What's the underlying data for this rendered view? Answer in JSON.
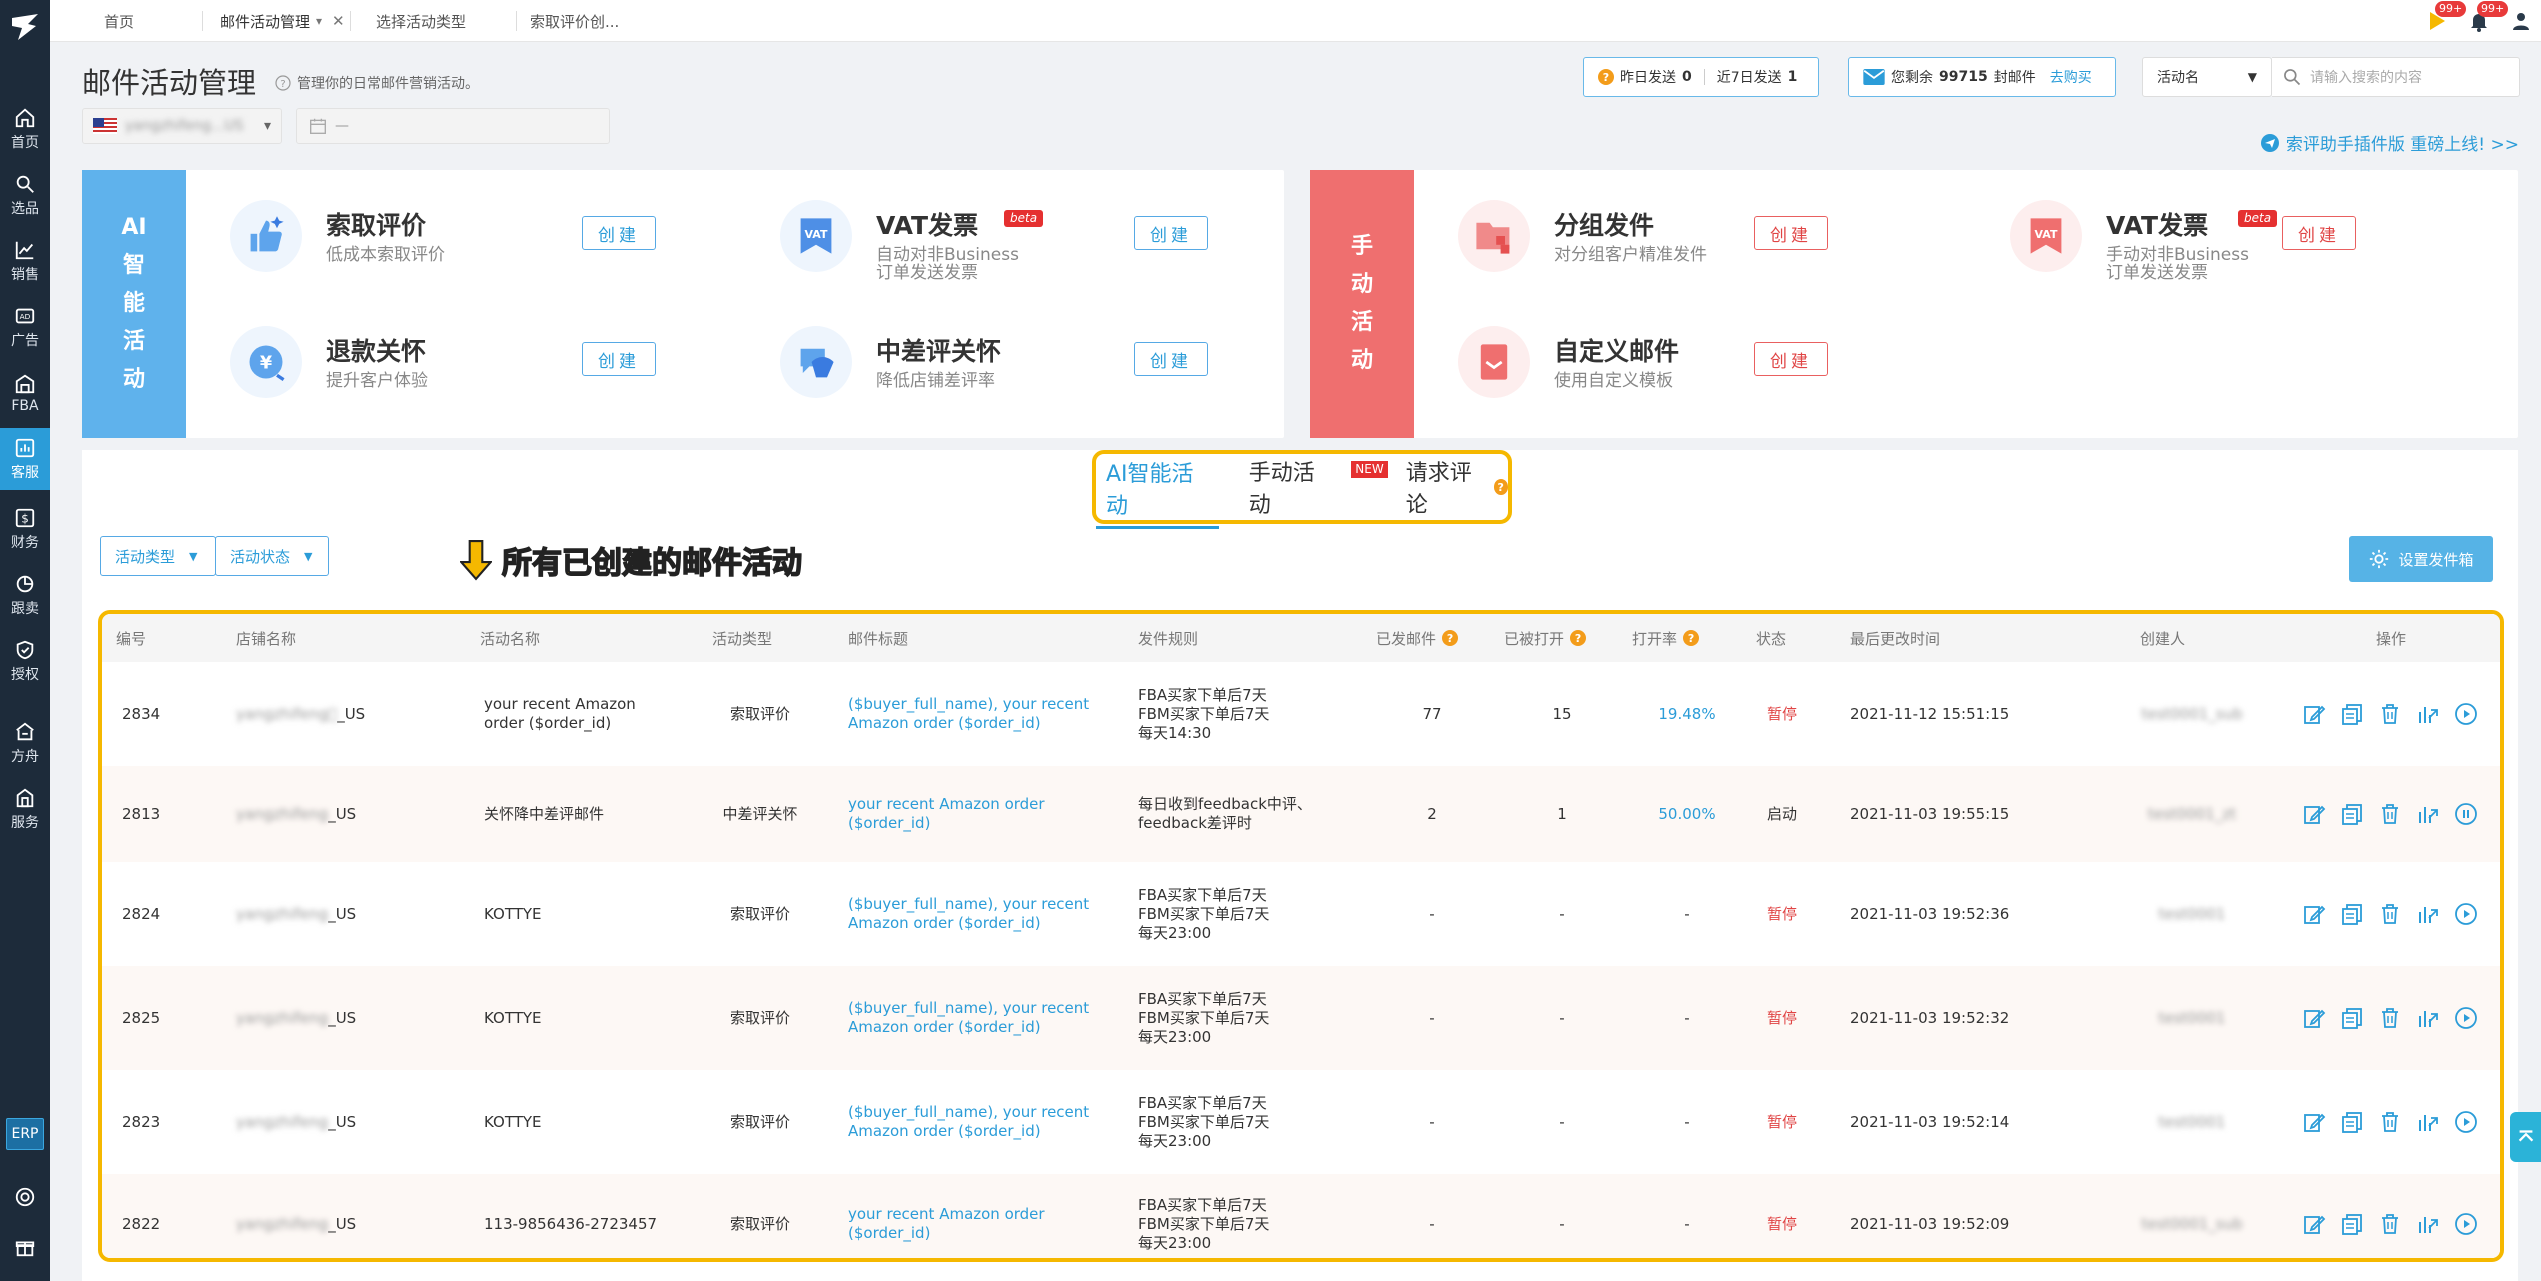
{
  "nav": {
    "items": [
      {
        "label": "首页"
      },
      {
        "label": "选品"
      },
      {
        "label": "销售"
      },
      {
        "label": "广告"
      },
      {
        "label": "FBA"
      },
      {
        "label": "客服"
      },
      {
        "label": "财务"
      },
      {
        "label": "跟卖"
      },
      {
        "label": "授权"
      },
      {
        "label": "方舟"
      },
      {
        "label": "服务"
      }
    ],
    "erp": "ERP"
  },
  "tabs": [
    {
      "label": "首页"
    },
    {
      "label": "邮件活动管理"
    },
    {
      "label": "选择活动类型"
    },
    {
      "label": "索取评价创..."
    }
  ],
  "top_badges": {
    "flag": "99+",
    "bell": "99+"
  },
  "header": {
    "title": "邮件活动管理",
    "desc": "管理你的日常邮件营销活动。",
    "store_value": "yangzhifeng...US",
    "date_value": "—",
    "yesterday_label": "昨日发送",
    "yesterday_value": "0",
    "week_label": "近7日发送",
    "week_value": "1",
    "quota_label": "您剩余",
    "quota_value": "99715",
    "quota_unit": "封邮件",
    "buy_link": "去购买",
    "search_type": "活动名",
    "search_placeholder": "请输入搜索的内容",
    "promo": "索评助手插件版 重磅上线! >>"
  },
  "ai_panel": {
    "label": [
      "AI",
      "智",
      "能",
      "活",
      "动"
    ],
    "cards": [
      {
        "title": "索取评价",
        "sub": "低成本索取评价",
        "btn": "创建"
      },
      {
        "title": "VAT发票",
        "sub": "自动对非Business\n订单发送发票",
        "btn": "创建",
        "badge": "beta"
      },
      {
        "title": "退款关怀",
        "sub": "提升客户体验",
        "btn": "创建"
      },
      {
        "title": "中差评关怀",
        "sub": "降低店铺差评率",
        "btn": "创建"
      }
    ]
  },
  "manual_panel": {
    "label": [
      "手",
      "动",
      "活",
      "动"
    ],
    "cards": [
      {
        "title": "分组发件",
        "sub": "对分组客户精准发件",
        "btn": "创建"
      },
      {
        "title": "VAT发票",
        "sub": "手动对非Business\n订单发送发票",
        "btn": "创建",
        "badge": "beta"
      },
      {
        "title": "自定义邮件",
        "sub": "使用自定义模板",
        "btn": "创建"
      }
    ]
  },
  "segments": {
    "ai": "AI智能活动",
    "manual": "手动活动",
    "review": "请求评论",
    "new": "NEW"
  },
  "filters": {
    "type": "活动类型",
    "status": "活动状态"
  },
  "annotation": "所有已创建的邮件活动",
  "sender_btn": "设置发件箱",
  "table": {
    "headers": [
      "编号",
      "店铺名称",
      "活动名称",
      "活动类型",
      "邮件标题",
      "发件规则",
      "已发邮件",
      "已被打开",
      "打开率",
      "状态",
      "最后更改时间",
      "创建人",
      "操作"
    ],
    "rows": [
      {
        "id": "2834",
        "store": "yangzhifeng\u0000",
        "store_suffix": "_US",
        "name": "your recent Amazon\norder ($order_id)",
        "type": "索取评价",
        "subject": "($buyer_full_name), your recent\nAmazon order ($order_id)",
        "rule": "FBA买家下单后7天\nFBM买家下单后7天\n每天14:30",
        "sent": "77",
        "opened": "15",
        "rate": "19.48%",
        "status": "暂停",
        "time": "2021-11-12 15:51:15",
        "creator": "test0001_sub"
      },
      {
        "id": "2813",
        "store": "yangzhifeng",
        "store_suffix": "_US",
        "name": "关怀降中差评邮件",
        "type": "中差评关怀",
        "subject": "your recent Amazon order ($order_id)",
        "rule": "每日收到feedback中评、\nfeedback差评时",
        "sent": "2",
        "opened": "1",
        "rate": "50.00%",
        "status": "启动",
        "time": "2021-11-03 19:55:15",
        "creator": "test0001_zt"
      },
      {
        "id": "2824",
        "store": "yangzhifeng",
        "store_suffix": "_US",
        "name": "KOTTYE",
        "type": "索取评价",
        "subject": "($buyer_full_name), your recent\nAmazon order ($order_id)",
        "rule": "FBA买家下单后7天\nFBM买家下单后7天\n每天23:00",
        "sent": "-",
        "opened": "-",
        "rate": "-",
        "status": "暂停",
        "time": "2021-11-03 19:52:36",
        "creator": "test0001"
      },
      {
        "id": "2825",
        "store": "yangzhifeng",
        "store_suffix": "_US",
        "name": "KOTTYE",
        "type": "索取评价",
        "subject": "($buyer_full_name), your recent\nAmazon order ($order_id)",
        "rule": "FBA买家下单后7天\nFBM买家下单后7天\n每天23:00",
        "sent": "-",
        "opened": "-",
        "rate": "-",
        "status": "暂停",
        "time": "2021-11-03 19:52:32",
        "creator": "test0001"
      },
      {
        "id": "2823",
        "store": "yangzhifeng",
        "store_suffix": "_US",
        "name": "KOTTYE",
        "type": "索取评价",
        "subject": "($buyer_full_name), your recent\nAmazon order ($order_id)",
        "rule": "FBA买家下单后7天\nFBM买家下单后7天\n每天23:00",
        "sent": "-",
        "opened": "-",
        "rate": "-",
        "status": "暂停",
        "time": "2021-11-03 19:52:14",
        "creator": "test0001"
      },
      {
        "id": "2822",
        "store": "yangzhifeng",
        "store_suffix": "_US",
        "name": "113-9856436-2723457",
        "type": "索取评价",
        "subject": "your recent Amazon order ($order_id)",
        "rule": "FBA买家下单后7天\nFBM买家下单后7天\n每天23:00",
        "sent": "-",
        "opened": "-",
        "rate": "-",
        "status": "暂停",
        "time": "2021-11-03 19:52:09",
        "creator": "test0001_sub"
      }
    ]
  },
  "colors": {
    "accent": "#2b9cd8",
    "ai": "#5fb2ec",
    "manual": "#ef6f6f",
    "highlight": "#f5b800",
    "danger": "#e04545"
  }
}
